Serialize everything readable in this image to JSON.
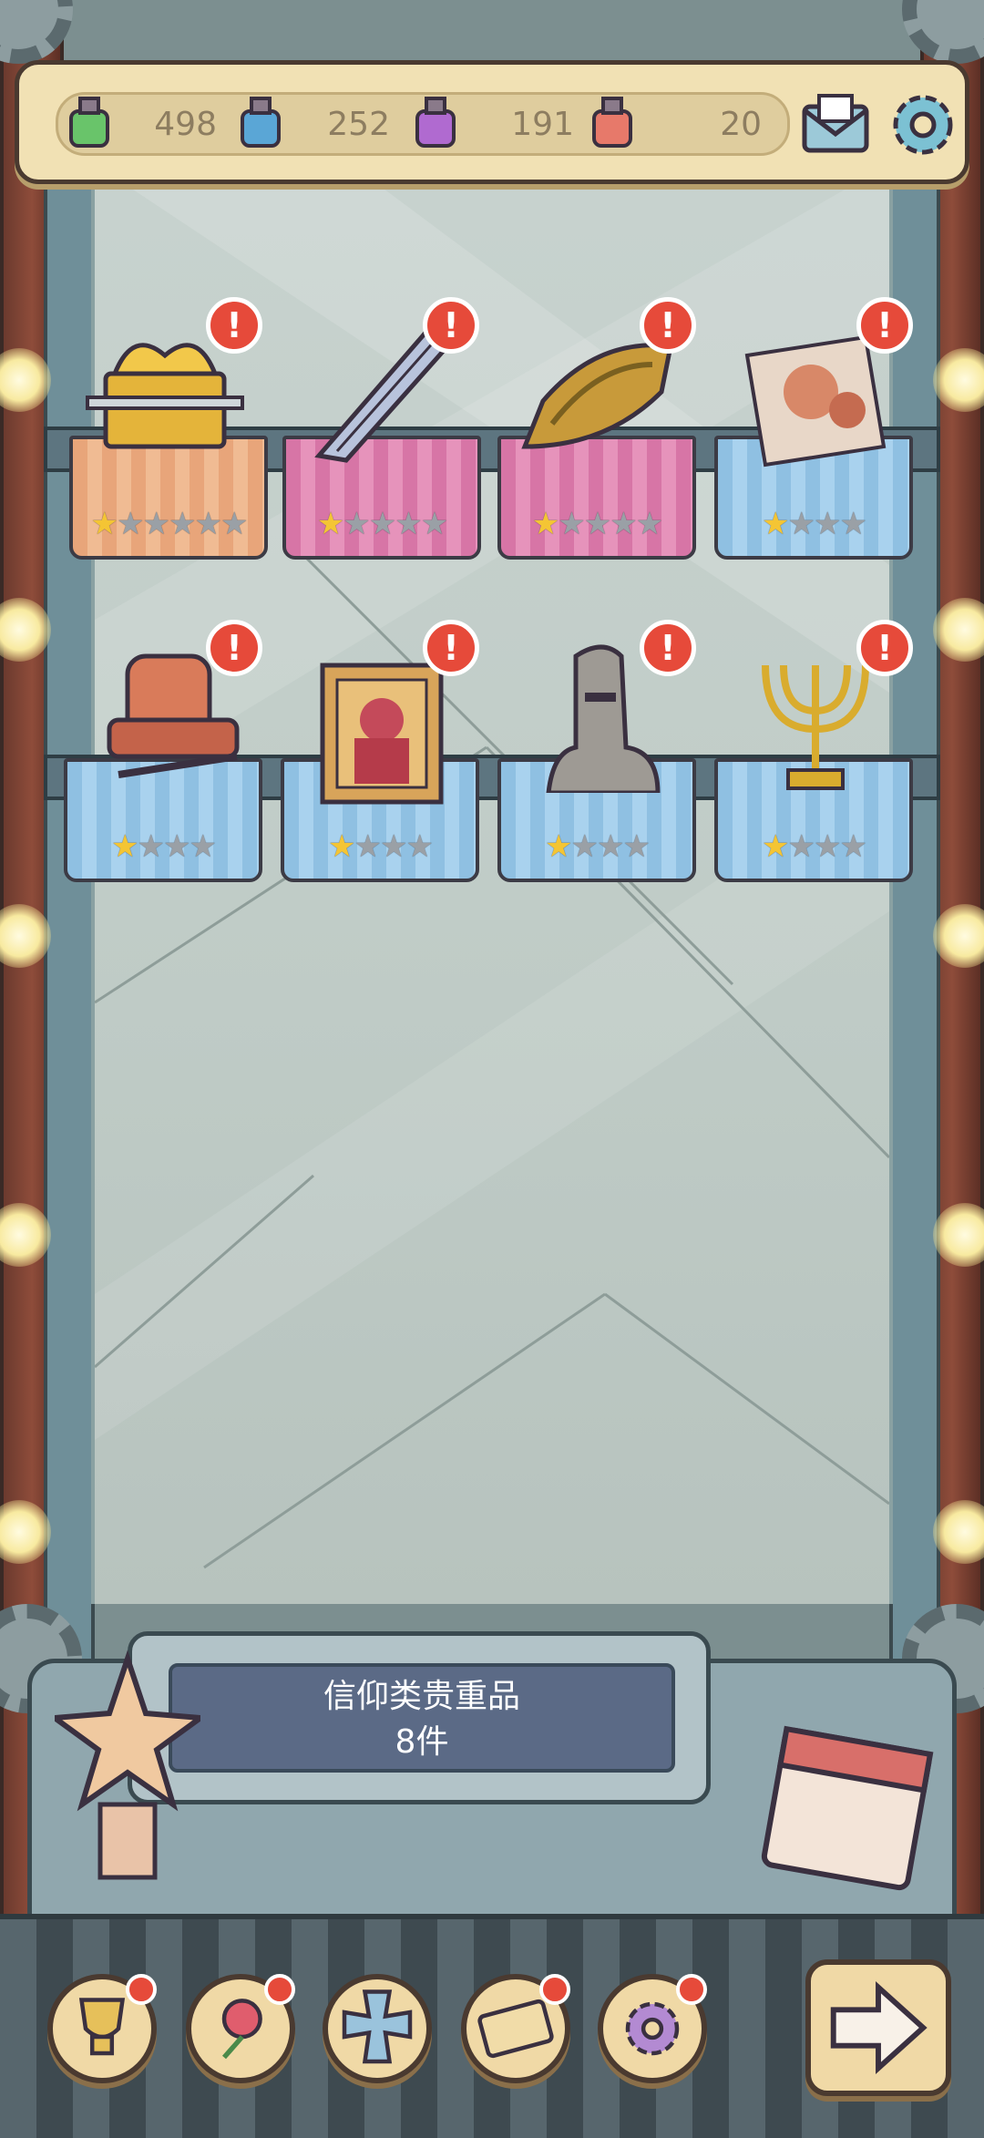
{
  "resources": [
    {
      "icon": "green-potion-icon",
      "value": "498"
    },
    {
      "icon": "blue-potion-icon",
      "value": "252"
    },
    {
      "icon": "purple-potion-icon",
      "value": "191"
    },
    {
      "icon": "red-potion-icon",
      "value": "20"
    }
  ],
  "topbar": {
    "mail_icon": "mail-icon",
    "settings_icon": "gear-icon"
  },
  "shelves": [
    [
      {
        "name": "ark-of-covenant",
        "cloth": "orange",
        "stars_filled": 1,
        "stars_total": 6
      },
      {
        "name": "ceremonial-dagger",
        "cloth": "pink",
        "stars_filled": 1,
        "stars_total": 5
      },
      {
        "name": "sarcophagus",
        "cloth": "pink",
        "stars_filled": 1,
        "stars_total": 5
      },
      {
        "name": "fresco-fragment",
        "cloth": "blue",
        "stars_filled": 1,
        "stars_total": 4
      }
    ],
    [
      {
        "name": "throne-chair",
        "cloth": "blue",
        "stars_filled": 1,
        "stars_total": 4
      },
      {
        "name": "icon-painting",
        "cloth": "blue",
        "stars_filled": 1,
        "stars_total": 4
      },
      {
        "name": "moai-statue",
        "cloth": "blue",
        "stars_filled": 1,
        "stars_total": 4
      },
      {
        "name": "menorah",
        "cloth": "blue",
        "stars_filled": 1,
        "stars_total": 4
      }
    ]
  ],
  "collection": {
    "title": "信仰类贵重品",
    "count": "8件"
  },
  "bottom_nav": [
    {
      "icon": "trophy-icon",
      "badge": true
    },
    {
      "icon": "rose-icon",
      "badge": true
    },
    {
      "icon": "cross-icon",
      "badge": false
    },
    {
      "icon": "scroll-icon",
      "badge": true
    },
    {
      "icon": "gear-icon",
      "badge": true
    }
  ],
  "next_icon": "arrow-right-icon",
  "colors": {
    "alert": "#e64a3a",
    "star_on": "#f4c534",
    "star_off": "#9aa0a6"
  }
}
